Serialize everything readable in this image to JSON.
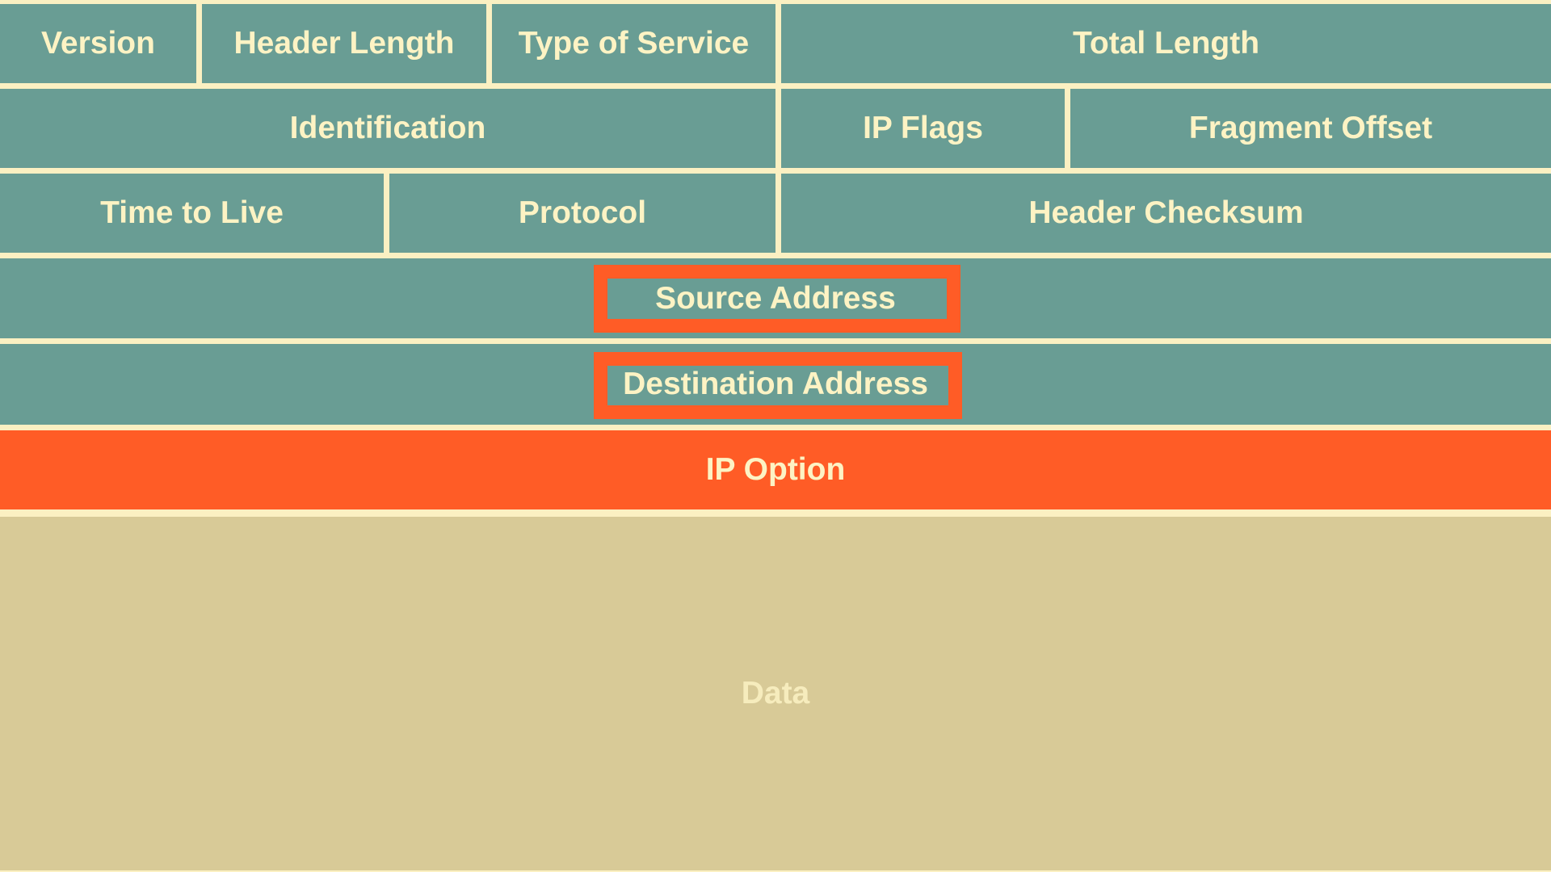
{
  "diagram": {
    "row1": [
      "Version",
      "Header Length",
      "Type of Service",
      "Total Length"
    ],
    "row2": [
      "Identification",
      "IP Flags",
      "Fragment Offset"
    ],
    "row3": [
      "Time to Live",
      "Protocol",
      "Header Checksum"
    ],
    "source": "Source Address",
    "destination": "Destination Address",
    "option": "IP Option",
    "data": "Data",
    "highlighted": [
      "Source Address",
      "Destination Address"
    ]
  },
  "colors": {
    "field": "#699d94",
    "divider": "#fbf0c2",
    "highlight": "#ff5c26",
    "data": "#d8ca97",
    "text": "#fdf3c4"
  }
}
